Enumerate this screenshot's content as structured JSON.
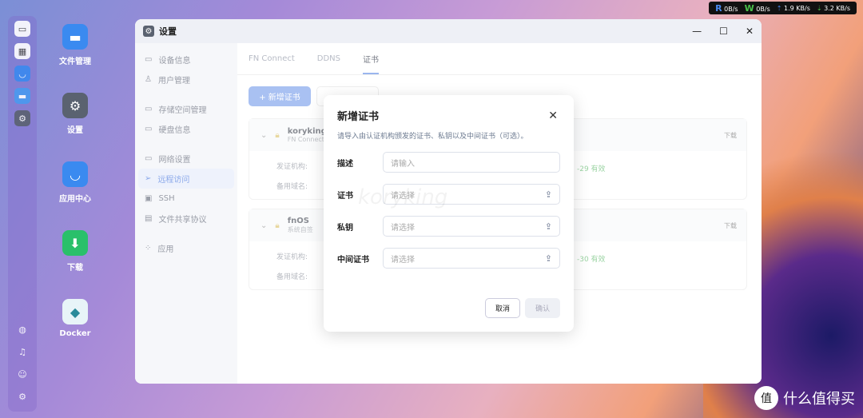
{
  "netbar": {
    "read": "0B/s",
    "write": "0B/s",
    "up": "1.9 KB/s",
    "down": "3.2 KB/s",
    "r": "R",
    "w": "W"
  },
  "desktop": [
    {
      "label": "文件管理"
    },
    {
      "label": "设置"
    },
    {
      "label": "应用中心"
    },
    {
      "label": "下载"
    },
    {
      "label": "Docker"
    }
  ],
  "window": {
    "title": "设置",
    "minimize": "—",
    "maximize": "☐",
    "close": "✕"
  },
  "sidebar": {
    "items": [
      {
        "label": "设备信息"
      },
      {
        "label": "用户管理"
      },
      {
        "label": "存储空间管理"
      },
      {
        "label": "硬盘信息"
      },
      {
        "label": "网络设置"
      },
      {
        "label": "远程访问"
      },
      {
        "label": "SSH"
      },
      {
        "label": "文件共享协议"
      },
      {
        "label": "应用"
      }
    ]
  },
  "tabs": [
    "FN Connect",
    "DDNS",
    "证书"
  ],
  "add_cert": "+ 新增证书",
  "cards": [
    {
      "name": "koryking",
      "sub": "FN Connect",
      "download": "下载",
      "issuer": "发证机构:",
      "alt": "备用域名:",
      "valid": "-29 有效"
    },
    {
      "name": "fnOS",
      "sub": "系统自签",
      "download": "下载",
      "issuer": "发证机构:",
      "alt": "备用域名:",
      "valid": "-30 有效"
    }
  ],
  "dialog": {
    "title": "新增证书",
    "desc": "请导入由认证机构颁发的证书、私钥以及中间证书（可选）。",
    "fields": [
      {
        "label": "描述",
        "placeholder": "请输入"
      },
      {
        "label": "证书",
        "placeholder": "请选择"
      },
      {
        "label": "私钥",
        "placeholder": "请选择"
      },
      {
        "label": "中间证书",
        "placeholder": "请选择"
      }
    ],
    "cancel": "取消",
    "confirm": "确认",
    "watermark": "koryking"
  },
  "brand": {
    "name": "什么值得买",
    "mark": "值"
  }
}
